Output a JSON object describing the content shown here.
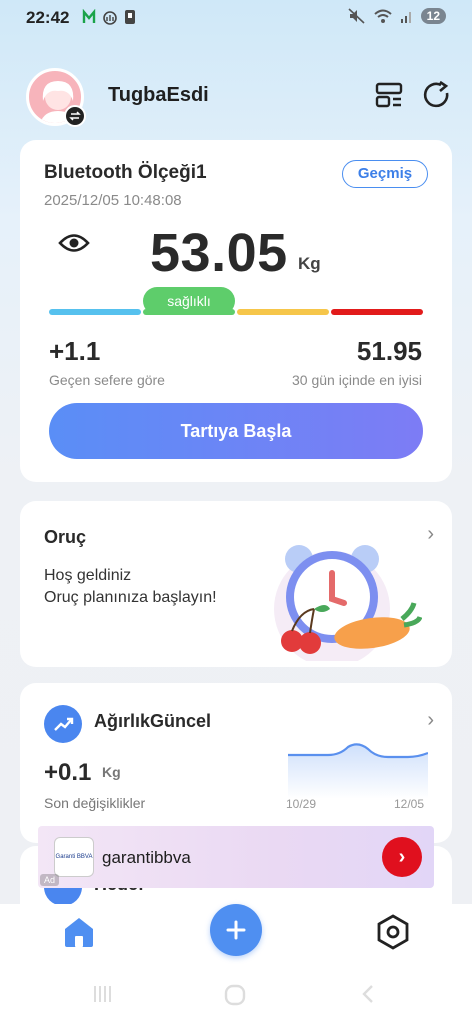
{
  "status_bar": {
    "time": "22:42",
    "battery": "12"
  },
  "header": {
    "username": "TugbaEsdi"
  },
  "scale_card": {
    "device_name": "Bluetooth Ölçeği1",
    "datetime": "2025/12/05 10:48:08",
    "history_label": "Geçmiş",
    "weight": "53.05",
    "unit": "Kg",
    "status_label": "sağlıklı",
    "delta_value": "+1.1",
    "delta_label": "Geçen sefere göre",
    "best_value": "51.95",
    "best_label": "30 gün içinde en iyisi",
    "start_label": "Tartıya Başla",
    "colors": {
      "segment_1": "#56c1ee",
      "segment_2": "#5ecd6b",
      "segment_3": "#f6c64a",
      "segment_4": "#e21b1b"
    }
  },
  "fasting_card": {
    "title": "Oruç",
    "line1": "Hoş geldiniz",
    "line2": "Oruç planınıza başlayın!"
  },
  "weight_card": {
    "title": "AğırlıkGüncel",
    "delta": "+0.1",
    "unit": "Kg",
    "label": "Son değişiklikler",
    "date_start": "10/29",
    "date_end": "12/05"
  },
  "next_card": {
    "title": "Hedef"
  },
  "ad": {
    "brand": "garantibbva",
    "logo_text": "Garanti BBVA",
    "tag": "Ad"
  },
  "nav": {
    "home": "home-icon",
    "add": "plus-icon",
    "settings": "settings-icon"
  }
}
